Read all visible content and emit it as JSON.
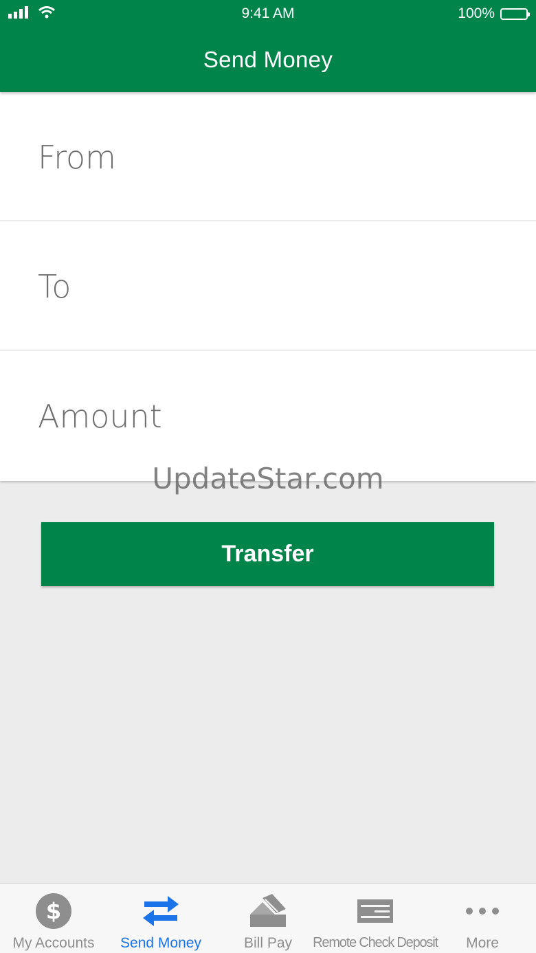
{
  "status_bar": {
    "time": "9:41 AM",
    "battery": "100%"
  },
  "header": {
    "title": "Send Money"
  },
  "form": {
    "from_label": "From",
    "to_label": "To",
    "amount_label": "Amount"
  },
  "watermark": "UpdateStar.com",
  "transfer_button_label": "Transfer",
  "tabs": [
    {
      "label": "My Accounts",
      "icon": "dollar-icon"
    },
    {
      "label": "Send Money",
      "icon": "transfer-arrows-icon",
      "active": true
    },
    {
      "label": "Bill Pay",
      "icon": "bill-pay-icon"
    },
    {
      "label": "Remote Check Deposit",
      "icon": "check-deposit-icon"
    },
    {
      "label": "More",
      "icon": "more-dots-icon"
    }
  ],
  "colors": {
    "brand_green": "#00844a",
    "active_tab_blue": "#1a73e8",
    "inactive_tab_gray": "#8e8e8e",
    "background": "#ececec"
  }
}
